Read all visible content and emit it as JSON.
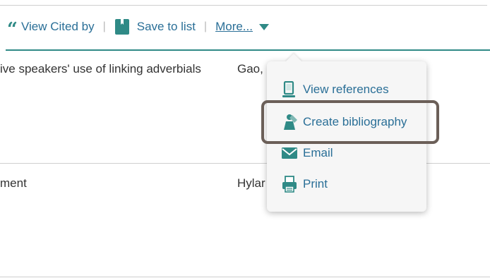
{
  "toolbar": {
    "view_cited_by": "View Cited by",
    "separator": "|",
    "save_to_list": "Save to list",
    "more": "More..."
  },
  "results": [
    {
      "title": "ive speakers' use of linking adverbials",
      "author": "Gao,"
    },
    {
      "title": "ment",
      "author": "Hylar"
    }
  ],
  "dropdown": {
    "items": [
      {
        "label": "View references",
        "icon": "view-references-icon"
      },
      {
        "label": "Create bibliography",
        "icon": "create-bibliography-icon"
      },
      {
        "label": "Email",
        "icon": "email-icon"
      },
      {
        "label": "Print",
        "icon": "print-icon"
      }
    ]
  },
  "colors": {
    "link": "#2a6f97",
    "accent_teal": "#2f8a86",
    "highlight_border": "#6b5f58"
  }
}
